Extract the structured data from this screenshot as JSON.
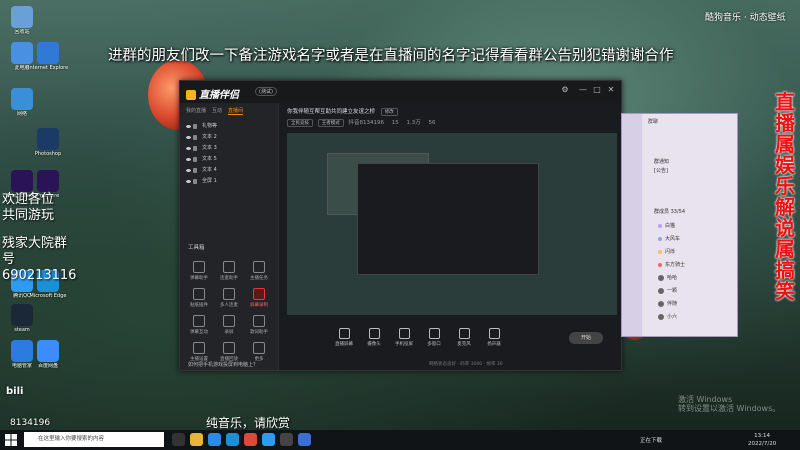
{
  "banner_text": "进群的朋友们改一下备注游戏名字或者是在直播间的名字记得看看群公告别犯错谢谢合作",
  "side_banner_vertical": "直播属娱乐解说属搞笑",
  "welcome_text": "欢迎各位共同游玩",
  "group_text": "残家大院群号690213116",
  "music_label": "酷狗音乐 · 动态壁纸",
  "subtitle": "纯音乐，请欣赏",
  "overlay_number": "8134196",
  "desktop_icons": [
    {
      "label": "回收站",
      "color": "#6aa0d8"
    },
    {
      "label": "此电脑",
      "color": "#4a90e2"
    },
    {
      "label": "Internet Explorer",
      "color": "#2f7ad6"
    },
    {
      "label": "网络",
      "color": "#3a8fd8"
    },
    {
      "label": "Photoshop",
      "color": "#1c3a66"
    },
    {
      "label": "After Effects",
      "color": "#2a1457"
    },
    {
      "label": "Premiere",
      "color": "#2a1457"
    },
    {
      "label": "腾讯QQ",
      "color": "#2d9cf0"
    },
    {
      "label": "Microsoft Edge",
      "color": "#1d8fd4"
    },
    {
      "label": "steam",
      "color": "#1b2838"
    },
    {
      "label": "电脑管家",
      "color": "#2b7be0"
    },
    {
      "label": "百度网盘",
      "color": "#3c8cff"
    }
  ],
  "app": {
    "logo": "直播伴侣",
    "version": "(测试)",
    "tabs": [
      "我的直播",
      "互动",
      "直播间"
    ],
    "active_tab": "直播间",
    "scenes": [
      "礼物等",
      "文本 2",
      "文本 3",
      "文本 5",
      "文本 4",
      "全屏 1"
    ],
    "tools_title": "工具箱",
    "tools": [
      "弹幕助手",
      "连麦助手",
      "主播任务",
      "贴纸插件",
      "多人连麦",
      "屏幕录制",
      "弹幕互动",
      "录屏",
      "歌词助手",
      "主播设置",
      "直播回放",
      "更多"
    ],
    "info_title": "你我伴随互帮互助共同建立友谊之桥",
    "info_badge": "修改",
    "info_tags": [
      "全民竞技",
      "王者模式"
    ],
    "info_id": "抖音8134196",
    "info_stats": [
      "15",
      "1.3万",
      "56"
    ],
    "controls": [
      "直播屏幕",
      "摄像头",
      "手机投屏",
      "多窗口",
      "麦克风",
      "扬声器"
    ],
    "start_label": "开始",
    "status_text": "网络状态良好 · 码率 3000 · 帧率 30",
    "notice": "如何把手机游戏投屏到电脑上？"
  },
  "chat": {
    "title": "群聊",
    "lines": [
      "群通知",
      "[公告]"
    ],
    "members_label": "群成员 33/54",
    "members": [
      "白猫",
      "大风车",
      "闪烁",
      "东方骑士",
      "哈哈",
      "一颗",
      "伴随",
      "小六"
    ]
  },
  "taskbar": {
    "search_placeholder": "在这里输入你要搜索的内容",
    "tray_text": "正在下载",
    "time": "13:14",
    "date": "2022/7/20"
  },
  "watermark": "激活 Windows\n转到设置以激活 Windows。"
}
